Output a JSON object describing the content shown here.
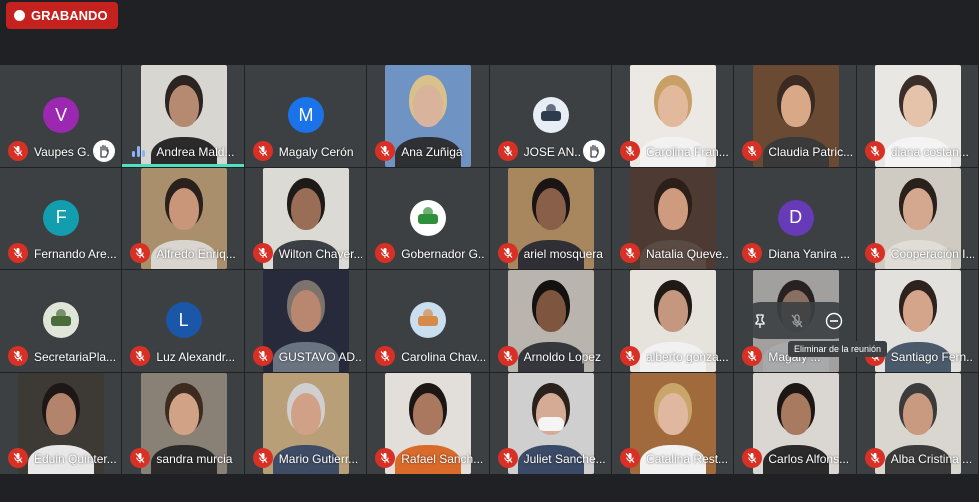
{
  "recording": {
    "label": "GRABANDO"
  },
  "hover_controls": {
    "tooltip": "Eliminar de la reunión"
  },
  "participants": [
    {
      "name": "Vaupes G...",
      "type": "avatar",
      "initial": "V",
      "color": "#9c27b0",
      "hand": true
    },
    {
      "name": "Andrea Mald...",
      "type": "video",
      "speaking": true,
      "skin": "#b58a70",
      "hair": "#2b2420",
      "bg": "#d8d6d1",
      "shirt": "#2a2a2a"
    },
    {
      "name": "Magaly Cerón",
      "type": "avatar",
      "initial": "M",
      "color": "#1a73e8"
    },
    {
      "name": "Ana Zuñiga",
      "type": "video",
      "skin": "#d9b39b",
      "hair": "#d8c18a",
      "bg": "#6f93c2",
      "shirt": "#2e3033"
    },
    {
      "name": "JOSE AN...",
      "type": "logo",
      "logo_bg": "#e8eef5",
      "logo_fg": "#2e3b4e",
      "hand": true
    },
    {
      "name": "Carolina Fran...",
      "type": "video",
      "skin": "#e2b99d",
      "hair": "#c8a066",
      "bg": "#ece9e4",
      "shirt": "#f2f2f2"
    },
    {
      "name": "Claudia Patric...",
      "type": "video",
      "skin": "#d9a887",
      "hair": "#3a2a22",
      "bg": "#6b4a34",
      "shirt": "#3a3a3a"
    },
    {
      "name": "diana costan...",
      "type": "video",
      "skin": "#e5c2aa",
      "hair": "#3b2e28",
      "bg": "#e9e7e4",
      "shirt": "#f4f4f4"
    },
    {
      "name": "Fernando Are...",
      "type": "avatar",
      "initial": "F",
      "color": "#129eaf"
    },
    {
      "name": "Alfredo Enriq...",
      "type": "video",
      "skin": "#c9967a",
      "hair": "#2a211c",
      "bg": "#a98f6b",
      "shirt": "#d9d5cf"
    },
    {
      "name": "Wilton Chaver...",
      "type": "video",
      "skin": "#9a6e56",
      "hair": "#1e1a18",
      "bg": "#dcdad4",
      "shirt": "#3b3f46"
    },
    {
      "name": "Gobernador G...",
      "type": "logo",
      "logo_bg": "#ffffff",
      "logo_fg": "#2f8f3a"
    },
    {
      "name": "ariel mosquera",
      "type": "video",
      "skin": "#8a5f4a",
      "hair": "#1a1514",
      "bg": "#a8875f",
      "shirt": "#2f2f35"
    },
    {
      "name": "Natalia Queve...",
      "type": "video",
      "skin": "#cf9b7e",
      "hair": "#2c1f1a",
      "bg": "#4d3b33",
      "shirt": "#5a4a44"
    },
    {
      "name": "Diana Yanira ...",
      "type": "avatar",
      "initial": "D",
      "color": "#673ab7"
    },
    {
      "name": "Cooperación I...",
      "type": "video",
      "skin": "#d4a88e",
      "hair": "#2a201c",
      "bg": "#cfcac2",
      "shirt": "#e0ddd7"
    },
    {
      "name": "SecretariaPla...",
      "type": "logo",
      "logo_bg": "#dfe6d9",
      "logo_fg": "#4a6c3a"
    },
    {
      "name": "Luz Alexandr...",
      "type": "avatar",
      "initial": "L",
      "color": "#1a57a8"
    },
    {
      "name": "GUSTAVO AD...",
      "type": "video",
      "skin": "#b98770",
      "hair": "#7c736c",
      "bg": "#262a3a",
      "shirt": "#6a7480"
    },
    {
      "name": "Carolina Chav...",
      "type": "logo",
      "logo_bg": "#c9dff0",
      "logo_fg": "#d68a4a"
    },
    {
      "name": "Arnoldo Lopez",
      "type": "video",
      "skin": "#7e553f",
      "hair": "#141111",
      "bg": "#b9b4ad",
      "shirt": "#35373d"
    },
    {
      "name": "alberto gonza...",
      "type": "video",
      "skin": "#c4977e",
      "hair": "#201a17",
      "bg": "#e6e3dd",
      "shirt": "#f1f1f1"
    },
    {
      "name": "Magaly ...",
      "type": "video",
      "skin": "#c49782",
      "hair": "#2b2220",
      "bg": "#e8e4df",
      "shirt": "#f2f2f2",
      "hovered": true
    },
    {
      "name": "Santiago Fern...",
      "type": "video",
      "skin": "#d4a58a",
      "hair": "#2d221d",
      "bg": "#e3e1dd",
      "shirt": "#4b5a6b"
    },
    {
      "name": "Eduin Quinter...",
      "type": "video",
      "skin": "#b3846b",
      "hair": "#1d1816",
      "bg": "#3d3a36",
      "shirt": "#e8e8e8"
    },
    {
      "name": "sandra murcia",
      "type": "video",
      "skin": "#d1a286",
      "hair": "#3d2b22",
      "bg": "#8a8176",
      "shirt": "#2b2b2b"
    },
    {
      "name": "Mario Gutierr...",
      "type": "video",
      "skin": "#d1a187",
      "hair": "#cfcfcf",
      "bg": "#b99f77",
      "shirt": "#3f4c66"
    },
    {
      "name": "Rafael Sanch...",
      "type": "video",
      "skin": "#a9785f",
      "hair": "#1c1614",
      "bg": "#e2dfda",
      "shirt": "#d96a2a"
    },
    {
      "name": "Juliet Sanche...",
      "type": "video",
      "skin": "#d6ab95",
      "hair": "#2a201c",
      "bg": "#cfcfcf",
      "shirt": "#3b4a66",
      "mask": true
    },
    {
      "name": "Catalina Rest...",
      "type": "video",
      "skin": "#e0b8a0",
      "hair": "#c8a66a",
      "bg": "#a06a3c",
      "shirt": "#f1f1f1"
    },
    {
      "name": "Carlos Alfons...",
      "type": "video",
      "skin": "#a87a60",
      "hair": "#1c1614",
      "bg": "#dad7d2",
      "shirt": "#2a2a2a"
    },
    {
      "name": "Alba Cristina ...",
      "type": "video",
      "skin": "#c99a80",
      "hair": "#3b3b3b",
      "bg": "#d9d6d0",
      "shirt": "#3b3b3b"
    }
  ]
}
